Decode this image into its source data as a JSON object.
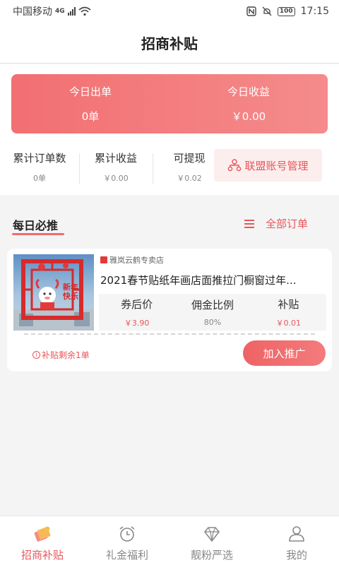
{
  "status_bar": {
    "carrier": "中国移动",
    "network": "4G",
    "battery": "100",
    "time": "17:15"
  },
  "header": {
    "title": "招商补贴"
  },
  "today": {
    "orders_label": "今日出单",
    "orders_value": "0单",
    "income_label": "今日收益",
    "income_value": "￥0.00"
  },
  "stats": {
    "total_orders_label": "累计订单数",
    "total_orders_value": "0单",
    "total_income_label": "累计收益",
    "total_income_value": "￥0.00",
    "withdrawable_label": "可提现",
    "withdrawable_value": "￥0.02",
    "alliance_button": "联盟账号管理"
  },
  "section": {
    "title": "每日必推",
    "all_orders": "全部订单"
  },
  "product": {
    "shop": "雅岚云鹤专卖店",
    "title": "2021春节贴纸年画店面推拉门橱窗过年...",
    "image_text": "新年快乐",
    "after_coupon_label": "券后价",
    "after_coupon_value": "￥3.90",
    "commission_label": "佣金比例",
    "commission_value": "80%",
    "subsidy_label": "补贴",
    "subsidy_value": "￥0.01",
    "remaining": "补贴剩余1单",
    "join_button": "加入推广"
  },
  "tabs": [
    {
      "label": "招商补贴",
      "icon": "ticket-icon",
      "active": true
    },
    {
      "label": "礼金福利",
      "icon": "alarm-clock-icon",
      "active": false
    },
    {
      "label": "靓粉严选",
      "icon": "diamond-icon",
      "active": false
    },
    {
      "label": "我的",
      "icon": "user-icon",
      "active": false
    }
  ],
  "colors": {
    "accent": "#e8565b",
    "card_gradient_start": "#f26f72",
    "card_gradient_end": "#f58b8b"
  }
}
